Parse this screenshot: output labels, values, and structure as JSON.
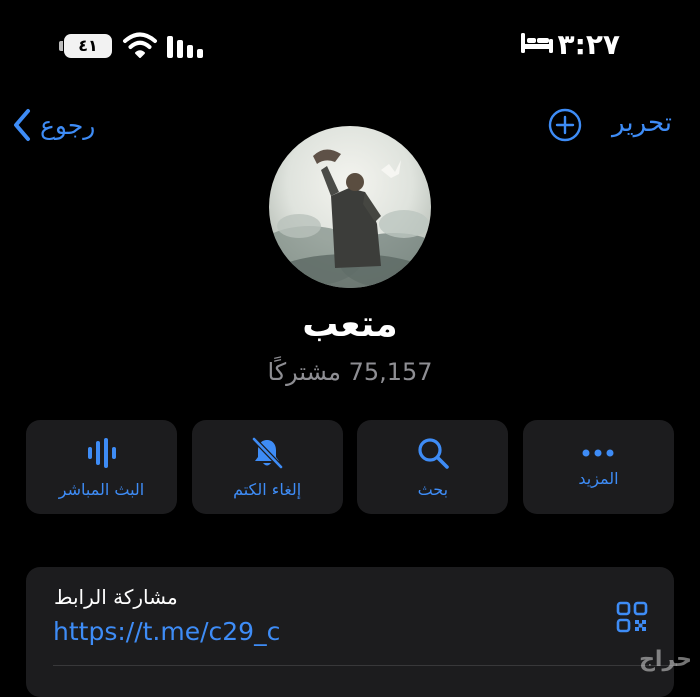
{
  "status_bar": {
    "time": "٣:٢٧",
    "battery": "٤١",
    "icons": [
      "bed-icon",
      "wifi-icon",
      "signal-icon",
      "battery-icon"
    ]
  },
  "nav": {
    "back_label": "رجوع",
    "edit_label": "تحرير",
    "icons": [
      "chevron-left-icon",
      "add-circle-icon"
    ]
  },
  "channel": {
    "name": "متعب",
    "subscribers": "75,157 مشتركًا"
  },
  "actions": [
    {
      "label": "المزيد",
      "icon": "more-dots-icon"
    },
    {
      "label": "بحث",
      "icon": "search-icon"
    },
    {
      "label": "إلغاء الكتم",
      "icon": "bell-slash-icon"
    },
    {
      "label": "البث المباشر",
      "icon": "live-waveform-icon"
    }
  ],
  "link": {
    "title": "مشاركة الرابط",
    "url": "https://t.me/c29_c",
    "icon": "qr-code-icon"
  },
  "watermark": "حراج",
  "colors": {
    "accent": "#3e8cf6",
    "background": "#000000",
    "card": "#1c1c1e",
    "secondary_text": "#8e8e93"
  }
}
